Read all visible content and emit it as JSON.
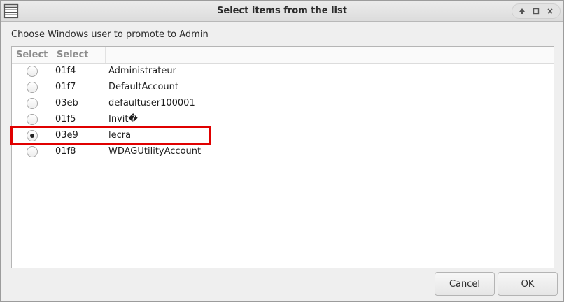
{
  "window": {
    "title": "Select items from the list",
    "icon": "list-table-icon"
  },
  "prompt": "Choose Windows user to promote to Admin",
  "table": {
    "headers": [
      "Select",
      "Select"
    ],
    "rows": [
      {
        "id": "01f4",
        "name": "Administrateur",
        "selected": false
      },
      {
        "id": "01f7",
        "name": "DefaultAccount",
        "selected": false
      },
      {
        "id": "03eb",
        "name": "defaultuser100001",
        "selected": false
      },
      {
        "id": "01f5",
        "name": "Invit�",
        "selected": false
      },
      {
        "id": "03e9",
        "name": "lecra",
        "selected": true
      },
      {
        "id": "01f8",
        "name": "WDAGUtilityAccount",
        "selected": false
      }
    ]
  },
  "buttons": {
    "cancel": "Cancel",
    "ok": "OK"
  },
  "annotation": {
    "color": "#e00000",
    "target_row": 4
  }
}
